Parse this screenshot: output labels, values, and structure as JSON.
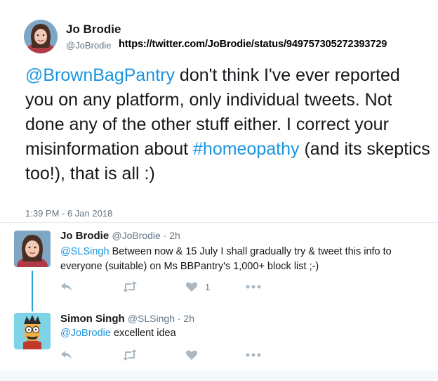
{
  "main_tweet": {
    "author_name": "Jo Brodie",
    "author_handle": "@JoBrodie",
    "status_url": "https://twitter.com/JoBrodie/status/949757305272393729",
    "text_mention": "@BrownBagPantry",
    "text_part1": " don't think I've ever reported you on any platform, only individual tweets. Not done any of the other stuff either. I correct your misinformation about ",
    "text_hashtag": "#homeopathy",
    "text_part2": " (and its skeptics too!), that is all :)",
    "timestamp": "1:39 PM - 6 Jan 2018"
  },
  "replies": [
    {
      "author_name": "Jo Brodie",
      "author_meta": "@JoBrodie · 2h",
      "mention": "@SLSingh",
      "text": " Between now & 15 July I shall gradually try & tweet this info to everyone (suitable) on Ms BBPantry's 1,000+ block list ;-)",
      "like_count": "1"
    },
    {
      "author_name": "Simon Singh",
      "author_meta": "@SLSingh · 2h",
      "mention": "@JoBrodie",
      "text": " excellent idea",
      "like_count": ""
    }
  ],
  "icons": {
    "reply": "reply-icon",
    "retweet": "retweet-icon",
    "like": "heart-icon",
    "more": "more-dots-icon"
  },
  "colors": {
    "link": "#1b95e0",
    "thread_line": "#2aa2d9",
    "secondary_text": "#657786",
    "action_icon": "#aab8c2"
  }
}
